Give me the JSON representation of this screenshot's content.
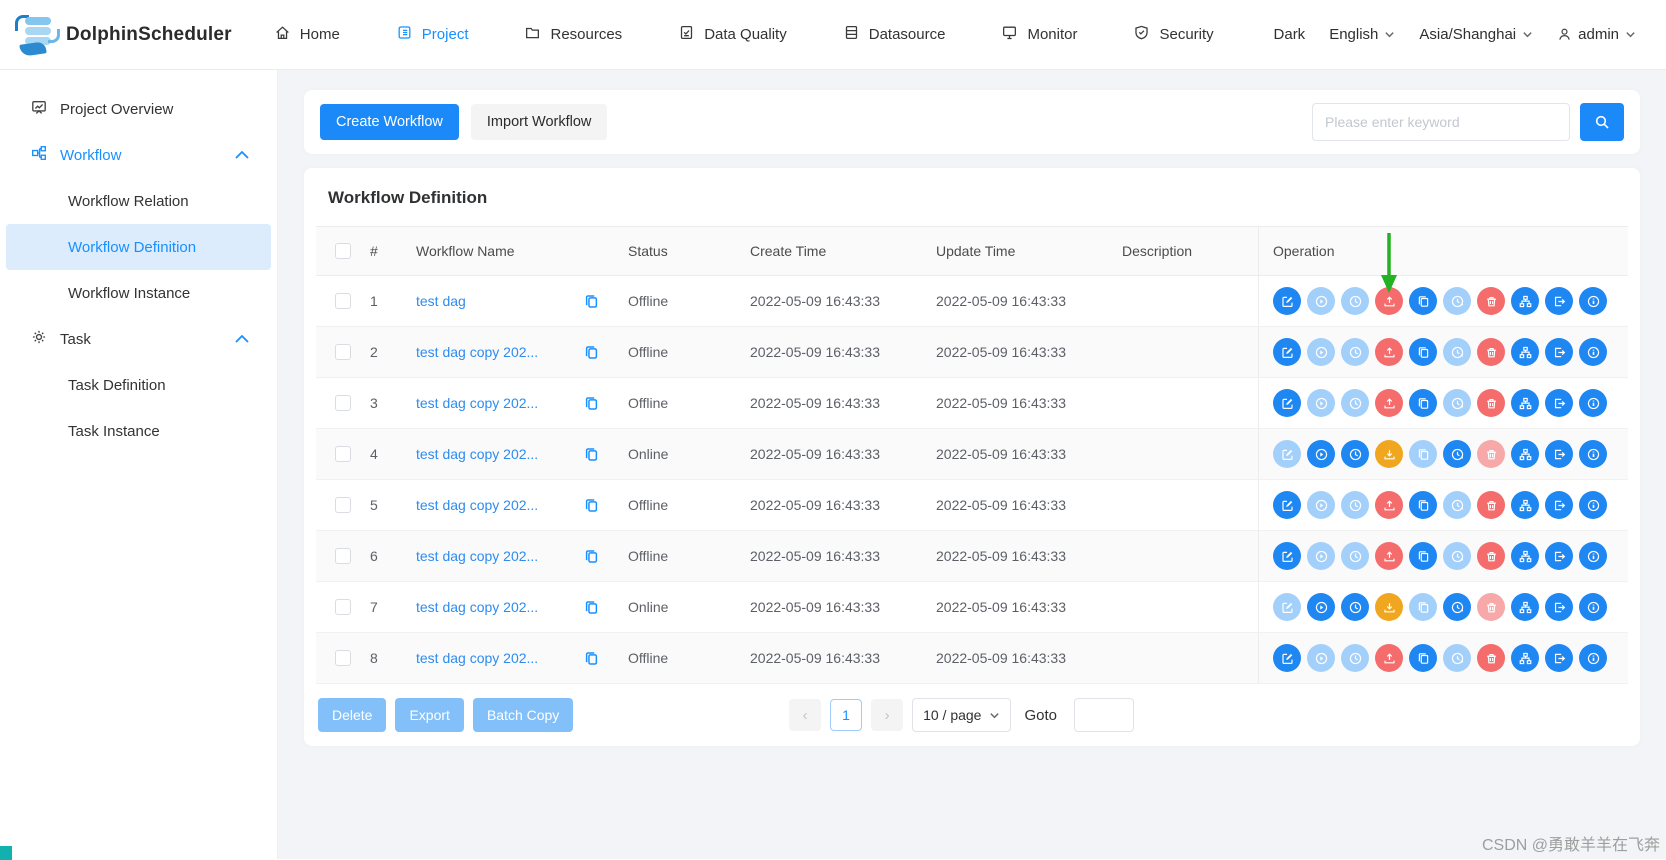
{
  "topnav": {
    "logo_text": "DolphinScheduler",
    "items": [
      {
        "id": "home",
        "label": "Home",
        "icon": "home-icon",
        "active": false
      },
      {
        "id": "project",
        "label": "Project",
        "icon": "project-icon",
        "active": true
      },
      {
        "id": "resources",
        "label": "Resources",
        "icon": "folder-icon",
        "active": false
      },
      {
        "id": "data-quality",
        "label": "Data Quality",
        "icon": "data-quality-icon",
        "active": false
      },
      {
        "id": "datasource",
        "label": "Datasource",
        "icon": "datasource-icon",
        "active": false
      },
      {
        "id": "monitor",
        "label": "Monitor",
        "icon": "monitor-icon",
        "active": false
      },
      {
        "id": "security",
        "label": "Security",
        "icon": "shield-icon",
        "active": false
      }
    ],
    "right": {
      "theme_label": "Dark",
      "language": "English",
      "timezone": "Asia/Shanghai",
      "user": "admin"
    }
  },
  "sidebar": {
    "items": [
      {
        "id": "project-overview",
        "label": "Project Overview",
        "icon": "overview-icon",
        "type": "top",
        "active": false
      },
      {
        "id": "workflow",
        "label": "Workflow",
        "icon": "workflow-icon",
        "type": "top",
        "active": true,
        "expanded": true,
        "children": [
          {
            "id": "workflow-relation",
            "label": "Workflow Relation",
            "active": false
          },
          {
            "id": "workflow-definition",
            "label": "Workflow Definition",
            "active": true
          },
          {
            "id": "workflow-instance",
            "label": "Workflow Instance",
            "active": false
          }
        ]
      },
      {
        "id": "task",
        "label": "Task",
        "icon": "gear-icon",
        "type": "top",
        "active": false,
        "expanded": true,
        "children": [
          {
            "id": "task-definition",
            "label": "Task Definition",
            "active": false
          },
          {
            "id": "task-instance",
            "label": "Task Instance",
            "active": false
          }
        ]
      }
    ]
  },
  "toolbar": {
    "create_label": "Create Workflow",
    "import_label": "Import Workflow",
    "search_placeholder": "Please enter keyword"
  },
  "panel": {
    "title": "Workflow Definition"
  },
  "table": {
    "columns": [
      "#",
      "Workflow Name",
      "Status",
      "Create Time",
      "Update Time",
      "Description",
      "Operation"
    ],
    "rows": [
      {
        "index": "1",
        "name": "test dag",
        "status": "Offline",
        "create_time": "2022-05-09 16:43:33",
        "update_time": "2022-05-09 16:43:33",
        "description": ""
      },
      {
        "index": "2",
        "name": "test dag copy 202...",
        "status": "Offline",
        "create_time": "2022-05-09 16:43:33",
        "update_time": "2022-05-09 16:43:33",
        "description": ""
      },
      {
        "index": "3",
        "name": "test dag copy 202...",
        "status": "Offline",
        "create_time": "2022-05-09 16:43:33",
        "update_time": "2022-05-09 16:43:33",
        "description": ""
      },
      {
        "index": "4",
        "name": "test dag copy 202...",
        "status": "Online",
        "create_time": "2022-05-09 16:43:33",
        "update_time": "2022-05-09 16:43:33",
        "description": ""
      },
      {
        "index": "5",
        "name": "test dag copy 202...",
        "status": "Offline",
        "create_time": "2022-05-09 16:43:33",
        "update_time": "2022-05-09 16:43:33",
        "description": ""
      },
      {
        "index": "6",
        "name": "test dag copy 202...",
        "status": "Offline",
        "create_time": "2022-05-09 16:43:33",
        "update_time": "2022-05-09 16:43:33",
        "description": ""
      },
      {
        "index": "7",
        "name": "test dag copy 202...",
        "status": "Online",
        "create_time": "2022-05-09 16:43:33",
        "update_time": "2022-05-09 16:43:33",
        "description": ""
      },
      {
        "index": "8",
        "name": "test dag copy 202...",
        "status": "Offline",
        "create_time": "2022-05-09 16:43:33",
        "update_time": "2022-05-09 16:43:33",
        "description": ""
      }
    ],
    "operation": {
      "button_names": [
        "edit-button",
        "start-button",
        "timing-button",
        "publish-toggle-button",
        "copy-workflow-button",
        "cron-manage-button",
        "delete-workflow-button",
        "tree-view-button",
        "export-workflow-button",
        "version-info-button"
      ],
      "icons_offline": [
        "edit",
        "play",
        "clock",
        "upload",
        "copy",
        "cron",
        "trash",
        "tree",
        "export",
        "info"
      ],
      "icons_online": [
        "edit",
        "play",
        "clock",
        "download",
        "copy",
        "cron",
        "trash",
        "tree",
        "export",
        "info"
      ],
      "colors_offline": [
        "blue",
        "lightblue",
        "lightblue",
        "red",
        "blue",
        "lightblue",
        "red",
        "blue",
        "blue",
        "blue"
      ],
      "colors_online": [
        "lightblue",
        "blue",
        "blue",
        "yellow",
        "lightblue",
        "blue",
        "pink",
        "blue",
        "blue",
        "blue"
      ]
    }
  },
  "footer": {
    "delete_label": "Delete",
    "export_label": "Export",
    "batch_copy_label": "Batch Copy",
    "prev_label": "‹",
    "current_page": "1",
    "next_label": "›",
    "page_size": "10 / page",
    "goto_label": "Goto"
  },
  "watermark": "CSDN @勇敢羊羊在飞奔",
  "colors": {
    "accent": "#1890ff",
    "op_blue": "#1f87f2",
    "op_lightblue": "#a3d0fa",
    "op_red": "#f56c6c",
    "op_pink": "#f7a9a9",
    "op_yellow": "#f0a71f",
    "arrow_green": "#23b223",
    "link": "#2d8cf0"
  }
}
